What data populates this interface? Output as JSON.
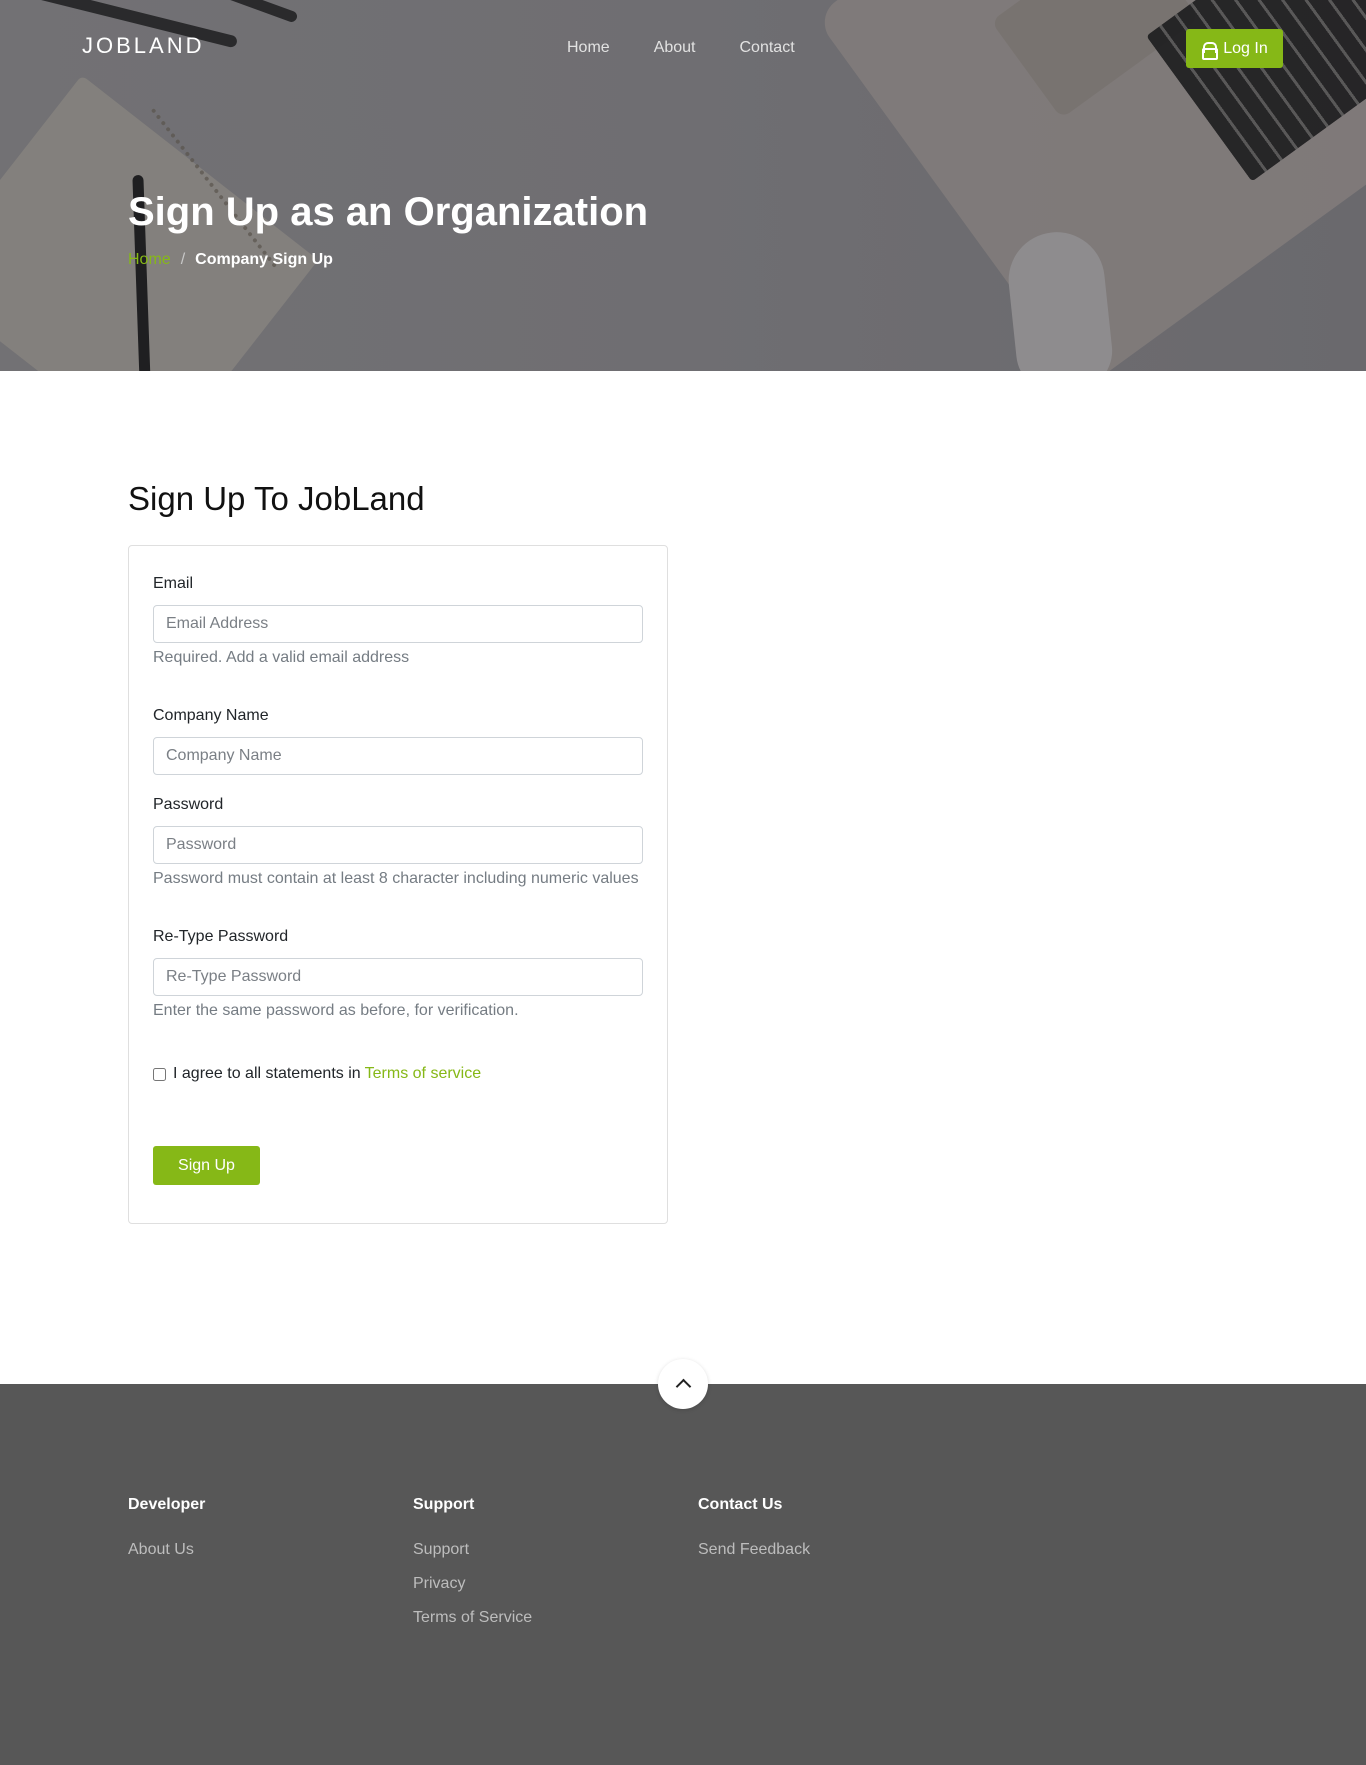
{
  "nav": {
    "brand": "JOBLAND",
    "links": [
      "Home",
      "About",
      "Contact"
    ],
    "login_label": "Log In"
  },
  "hero": {
    "title": "Sign Up as an Organization",
    "breadcrumb": {
      "home": "Home",
      "separator": "/",
      "current": "Company Sign Up"
    }
  },
  "form": {
    "heading": "Sign Up To JobLand",
    "email": {
      "label": "Email",
      "placeholder": "Email Address",
      "help": "Required. Add a valid email address"
    },
    "company": {
      "label": "Company Name",
      "placeholder": "Company Name"
    },
    "password": {
      "label": "Password",
      "placeholder": "Password",
      "help": "Password must contain at least 8 character including numeric values"
    },
    "retype": {
      "label": "Re-Type Password",
      "placeholder": "Re-Type Password",
      "help": "Enter the same password as before, for verification."
    },
    "agree_text": "I agree to all statements in",
    "tos_link": "Terms of service",
    "submit_label": "Sign Up"
  },
  "footer": {
    "columns": [
      {
        "heading": "Developer",
        "links": [
          "About Us"
        ]
      },
      {
        "heading": "Support",
        "links": [
          "Support",
          "Privacy",
          "Terms of Service"
        ]
      },
      {
        "heading": "Contact Us",
        "links": [
          "Send Feedback"
        ]
      }
    ]
  },
  "colors": {
    "accent": "#86b817",
    "footer_bg": "#575757",
    "hero_overlay": "#6e6d70"
  },
  "icons": {
    "login": "lock-icon",
    "back_to_top": "chevron-up-icon"
  }
}
